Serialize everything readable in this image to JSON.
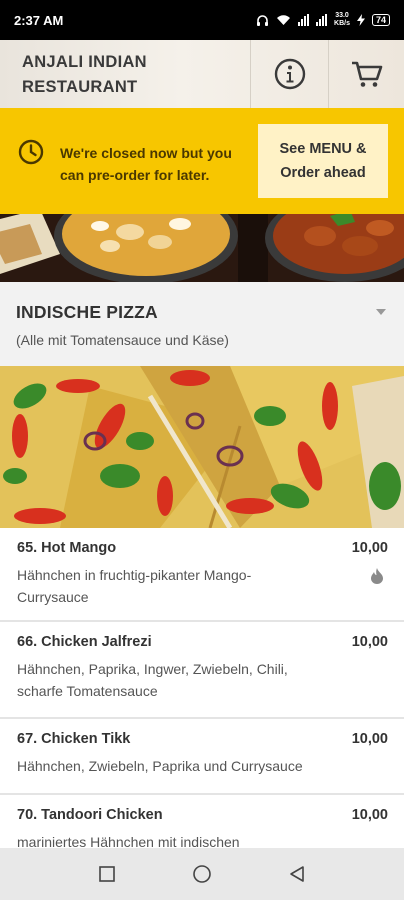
{
  "status": {
    "time": "2:37 AM",
    "net_speed_top": "33.0",
    "net_speed_unit": "KB/s",
    "battery": "74"
  },
  "header": {
    "restaurant_name_line1": "ANJALI INDIAN",
    "restaurant_name_line2": "RESTAURANT",
    "info_icon": "info-icon",
    "cart_icon": "cart-icon"
  },
  "banner": {
    "message_line1": "We're closed now but you",
    "message_line2": "can pre-order for later.",
    "button_line1": "See MENU &",
    "button_line2": "Order ahead"
  },
  "category": {
    "title": "INDISCHE PIZZA",
    "subtitle": "(Alle mit Tomatensauce und Käse)"
  },
  "items": [
    {
      "name": "65. Hot Mango",
      "price": "10,00",
      "desc_line1": "Hähnchen in fruchtig-pikanter Mango-",
      "desc_line2": "Currysauce",
      "spicy": true
    },
    {
      "name": "66. Chicken Jalfrezi",
      "price": "10,00",
      "desc_line1": "Hähnchen, Paprika, Ingwer, Zwiebeln, Chili,",
      "desc_line2": "scharfe Tomatensauce",
      "spicy": false
    },
    {
      "name": "67. Chicken Tikk",
      "price": "10,00",
      "desc_line1": "Hähnchen, Zwiebeln, Paprika und Currysauce",
      "desc_line2": "",
      "spicy": false
    },
    {
      "name": "70. Tandoori Chicken",
      "price": "10,00",
      "desc_line1": "mariniertes Hähnchen mit indischen",
      "desc_line2": "",
      "spicy": false
    }
  ],
  "colors": {
    "banner": "#f7c600",
    "banner_button": "#fff2c6",
    "background": "#f2f2f2"
  }
}
